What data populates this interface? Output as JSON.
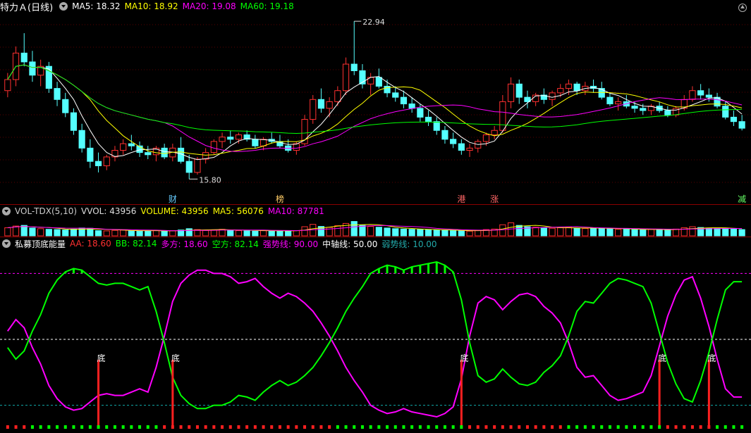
{
  "price_panel": {
    "title": "特力Ａ(日线)",
    "ma5": "MA5: 18.32",
    "ma10": "MA10: 18.92",
    "ma20": "MA20: 19.08",
    "ma60": "MA60: 19.18",
    "high_label": "22.94",
    "low_label": "15.80",
    "tags": [
      "财",
      "榜",
      "港",
      "涨",
      "减"
    ],
    "colors": {
      "ma5": "#ffffff",
      "ma10": "#ffff00",
      "ma20": "#ff00ff",
      "ma60": "#00ff00",
      "up": "#ff3030",
      "down": "#54ffff"
    }
  },
  "volume_panel": {
    "name": "VOL-TDX(5,10)",
    "vvol": "VVOL: 43956",
    "volume": "VOLUME: 43956",
    "ma5": "MA5: 56076",
    "ma10": "MA10: 87781"
  },
  "indicator_panel": {
    "name": "私募顶底能量",
    "aa": "AA: 18.60",
    "bb": "BB: 82.14",
    "duo": "多方: 18.60",
    "kong": "空方: 82.14",
    "strong": "强势线: 90.00",
    "mid": "中轴线: 50.00",
    "weak": "弱势线: 10.00",
    "bottom_label": "底"
  },
  "chart_data": [
    {
      "type": "candlestick",
      "title": "特力Ａ(日线)",
      "annotations": [
        "22.94",
        "15.80"
      ],
      "ohlc": [
        [
          19.8,
          20.6,
          19.5,
          20.3
        ],
        [
          20.3,
          21.8,
          20.0,
          21.5
        ],
        [
          21.5,
          22.4,
          20.9,
          21.1
        ],
        [
          21.1,
          21.6,
          20.2,
          20.5
        ],
        [
          20.5,
          21.2,
          20.0,
          20.9
        ],
        [
          20.9,
          21.1,
          19.7,
          19.9
        ],
        [
          19.9,
          20.2,
          19.1,
          19.4
        ],
        [
          19.4,
          19.7,
          18.6,
          18.8
        ],
        [
          18.8,
          19.0,
          17.8,
          18.0
        ],
        [
          18.0,
          18.3,
          17.0,
          17.2
        ],
        [
          17.2,
          17.6,
          16.3,
          16.6
        ],
        [
          16.6,
          17.0,
          16.1,
          16.4
        ],
        [
          16.4,
          16.9,
          16.2,
          16.8
        ],
        [
          16.8,
          17.3,
          16.6,
          17.1
        ],
        [
          17.1,
          17.6,
          16.9,
          17.4
        ],
        [
          17.4,
          17.8,
          17.1,
          17.3
        ],
        [
          17.3,
          17.5,
          16.8,
          17.0
        ],
        [
          17.0,
          17.3,
          16.7,
          16.9
        ],
        [
          16.9,
          17.3,
          16.6,
          17.2
        ],
        [
          17.2,
          17.4,
          16.7,
          16.8
        ],
        [
          16.8,
          17.4,
          16.6,
          17.2
        ],
        [
          17.2,
          17.7,
          16.5,
          16.6
        ],
        [
          16.6,
          16.9,
          15.8,
          16.1
        ],
        [
          16.1,
          16.8,
          16.0,
          16.7
        ],
        [
          16.7,
          17.2,
          16.5,
          17.0
        ],
        [
          17.0,
          17.6,
          16.9,
          17.5
        ],
        [
          17.5,
          17.9,
          17.2,
          17.7
        ],
        [
          17.7,
          18.0,
          17.4,
          17.6
        ],
        [
          17.6,
          17.9,
          17.4,
          17.8
        ],
        [
          17.8,
          18.0,
          17.5,
          17.6
        ],
        [
          17.6,
          17.8,
          17.2,
          17.3
        ],
        [
          17.3,
          17.7,
          17.1,
          17.6
        ],
        [
          17.6,
          17.9,
          17.4,
          17.5
        ],
        [
          17.5,
          17.8,
          17.2,
          17.3
        ],
        [
          17.3,
          17.6,
          17.0,
          17.1
        ],
        [
          17.1,
          17.5,
          16.9,
          17.4
        ],
        [
          17.4,
          18.7,
          17.3,
          18.5
        ],
        [
          18.5,
          19.6,
          18.3,
          19.4
        ],
        [
          19.4,
          19.9,
          18.8,
          19.0
        ],
        [
          19.0,
          19.5,
          18.6,
          19.3
        ],
        [
          19.3,
          20.0,
          19.1,
          19.8
        ],
        [
          19.8,
          21.3,
          19.6,
          21.0
        ],
        [
          21.0,
          22.94,
          20.5,
          20.7
        ],
        [
          20.7,
          21.0,
          19.9,
          20.1
        ],
        [
          20.1,
          20.6,
          19.6,
          20.4
        ],
        [
          20.4,
          20.8,
          19.9,
          20.0
        ],
        [
          20.0,
          20.3,
          19.5,
          19.7
        ],
        [
          19.7,
          20.0,
          19.3,
          19.5
        ],
        [
          19.5,
          19.8,
          19.0,
          19.2
        ],
        [
          19.2,
          19.5,
          18.8,
          19.0
        ],
        [
          19.0,
          19.2,
          18.4,
          18.6
        ],
        [
          18.6,
          18.9,
          18.2,
          18.4
        ],
        [
          18.4,
          18.6,
          17.8,
          18.0
        ],
        [
          18.0,
          18.2,
          17.4,
          17.6
        ],
        [
          17.6,
          17.9,
          17.2,
          17.4
        ],
        [
          17.4,
          17.6,
          16.9,
          17.1
        ],
        [
          17.1,
          17.4,
          16.8,
          17.2
        ],
        [
          17.2,
          17.6,
          17.0,
          17.5
        ],
        [
          17.5,
          17.9,
          17.3,
          17.8
        ],
        [
          17.8,
          18.2,
          17.6,
          18.0
        ],
        [
          18.0,
          19.6,
          17.9,
          19.3
        ],
        [
          19.3,
          20.4,
          19.0,
          20.1
        ],
        [
          20.1,
          20.3,
          19.2,
          19.5
        ],
        [
          19.5,
          19.8,
          19.0,
          19.3
        ],
        [
          19.3,
          19.7,
          19.1,
          19.6
        ],
        [
          19.6,
          19.9,
          19.2,
          19.4
        ],
        [
          19.4,
          19.8,
          19.1,
          19.7
        ],
        [
          19.7,
          20.1,
          19.5,
          19.9
        ],
        [
          19.9,
          20.3,
          19.6,
          20.1
        ],
        [
          20.1,
          20.2,
          19.6,
          19.8
        ],
        [
          19.8,
          20.2,
          19.6,
          20.0
        ],
        [
          20.0,
          20.3,
          19.7,
          19.9
        ],
        [
          19.9,
          20.2,
          19.4,
          19.5
        ],
        [
          19.5,
          19.7,
          19.1,
          19.2
        ],
        [
          19.2,
          19.5,
          18.9,
          19.3
        ],
        [
          19.3,
          19.6,
          19.0,
          19.1
        ],
        [
          19.1,
          19.3,
          18.8,
          19.0
        ],
        [
          19.0,
          19.2,
          18.7,
          18.9
        ],
        [
          18.9,
          19.2,
          18.7,
          19.1
        ],
        [
          19.1,
          19.3,
          18.8,
          18.9
        ],
        [
          18.9,
          19.1,
          18.6,
          18.7
        ],
        [
          18.7,
          19.1,
          18.6,
          19.0
        ],
        [
          19.0,
          19.6,
          18.9,
          19.4
        ],
        [
          19.4,
          20.0,
          19.3,
          19.8
        ],
        [
          19.8,
          20.1,
          19.4,
          19.6
        ],
        [
          19.6,
          19.9,
          19.3,
          19.5
        ],
        [
          19.5,
          19.7,
          19.0,
          19.1
        ],
        [
          19.1,
          19.3,
          18.5,
          18.6
        ],
        [
          18.6,
          18.9,
          18.2,
          18.4
        ],
        [
          18.4,
          18.7,
          18.0,
          18.1
        ]
      ],
      "ma_colors": [
        "#ffffff",
        "#ffff00",
        "#ff00ff",
        "#00ff00"
      ]
    },
    {
      "type": "bar",
      "title": "VOL-TDX(5,10)",
      "values": [
        62,
        75,
        80,
        60,
        55,
        50,
        48,
        45,
        52,
        60,
        58,
        40,
        38,
        42,
        44,
        40,
        35,
        38,
        42,
        36,
        40,
        45,
        55,
        48,
        42,
        46,
        50,
        44,
        40,
        38,
        36,
        42,
        40,
        38,
        35,
        40,
        70,
        88,
        72,
        65,
        78,
        95,
        110,
        80,
        72,
        66,
        60,
        55,
        52,
        50,
        48,
        46,
        44,
        42,
        40,
        38,
        36,
        42,
        48,
        52,
        85,
        100,
        80,
        70,
        66,
        60,
        58,
        62,
        64,
        58,
        56,
        60,
        58,
        54,
        50,
        52,
        48,
        46,
        50,
        48,
        46,
        52,
        62,
        70,
        64,
        60,
        56,
        58,
        52,
        48
      ]
    },
    {
      "type": "line",
      "title": "私募顶底能量",
      "ylim": [
        0,
        100
      ],
      "series": [
        {
          "name": "AA",
          "color": "#ff00ff",
          "values": [
            55,
            62,
            57,
            45,
            35,
            22,
            14,
            9,
            7,
            8,
            12,
            16,
            17,
            16,
            16,
            18,
            20,
            18,
            33,
            52,
            73,
            84,
            89,
            92,
            92,
            90,
            90,
            88,
            84,
            85,
            87,
            82,
            78,
            75,
            78,
            76,
            72,
            67,
            60,
            52,
            43,
            33,
            25,
            18,
            10,
            7,
            5,
            6,
            8,
            6,
            5,
            4,
            3,
            5,
            9,
            26,
            52,
            72,
            76,
            74,
            68,
            73,
            77,
            78,
            76,
            70,
            66,
            60,
            48,
            33,
            27,
            28,
            22,
            16,
            13,
            14,
            16,
            18,
            28,
            46,
            64,
            77,
            86,
            88,
            75,
            58,
            38,
            20,
            15,
            15
          ]
        },
        {
          "name": "BB",
          "color": "#00ff00",
          "values": [
            45,
            38,
            43,
            55,
            65,
            78,
            86,
            91,
            93,
            92,
            88,
            84,
            83,
            84,
            84,
            82,
            80,
            82,
            67,
            48,
            27,
            16,
            11,
            8,
            8,
            10,
            10,
            12,
            16,
            15,
            13,
            18,
            22,
            25,
            22,
            24,
            28,
            33,
            40,
            48,
            57,
            67,
            75,
            82,
            90,
            93,
            95,
            94,
            92,
            94,
            95,
            96,
            97,
            95,
            91,
            74,
            48,
            28,
            24,
            26,
            32,
            27,
            23,
            22,
            24,
            30,
            34,
            40,
            52,
            67,
            73,
            72,
            78,
            84,
            87,
            86,
            84,
            82,
            72,
            54,
            36,
            23,
            14,
            12,
            25,
            42,
            62,
            80,
            85,
            85
          ]
        }
      ],
      "reference_lines": [
        90,
        50,
        10
      ],
      "bottom_markers": [
        11,
        20,
        55,
        79,
        85
      ]
    }
  ]
}
